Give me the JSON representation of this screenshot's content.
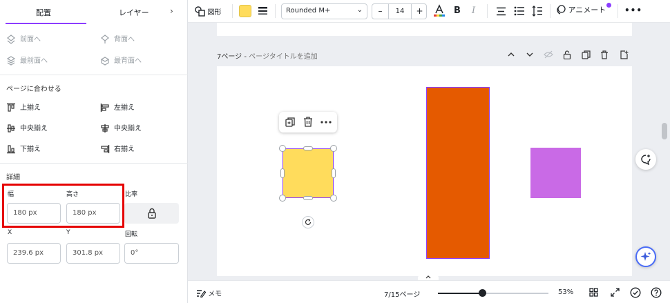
{
  "left_panel": {
    "tabs": [
      "配置",
      "レイヤー"
    ],
    "order": {
      "forward": "前面へ",
      "backward": "背面へ",
      "to_front": "最前面へ",
      "to_back": "最背面へ"
    },
    "align_title": "ページに合わせる",
    "align": {
      "top": "上揃え",
      "left": "左揃え",
      "middle": "中央揃え",
      "center": "中央揃え",
      "bottom": "下揃え",
      "right": "右揃え"
    },
    "details_title": "詳細",
    "width_label": "幅",
    "height_label": "高さ",
    "ratio_label": "比率",
    "width_value": "180 px",
    "height_value": "180 px",
    "x_label": "X",
    "y_label": "Y",
    "rotation_label": "回転",
    "x_value": "239.6 px",
    "y_value": "301.8 px",
    "rotation_value": "0°"
  },
  "toolbar": {
    "shape_label": "図形",
    "shape_color": "#ffdc5c",
    "font": "Rounded M+",
    "font_size": "14",
    "minus": "–",
    "plus": "+",
    "bold": "B",
    "italic": "I",
    "animate_label": "アニメート",
    "more": "•••"
  },
  "canvas": {
    "page_number_label": "7ページ",
    "page_title_placeholder": "ページタイトルを追加",
    "shape_colors": {
      "selected": "#ffdc5c",
      "orange": "#e55a00",
      "purple": "#c96ae6"
    }
  },
  "bottombar": {
    "notes_label": "メモ",
    "page_counter": "7/15ページ",
    "zoom_percent": "53%",
    "zoom_level": 0.4
  }
}
